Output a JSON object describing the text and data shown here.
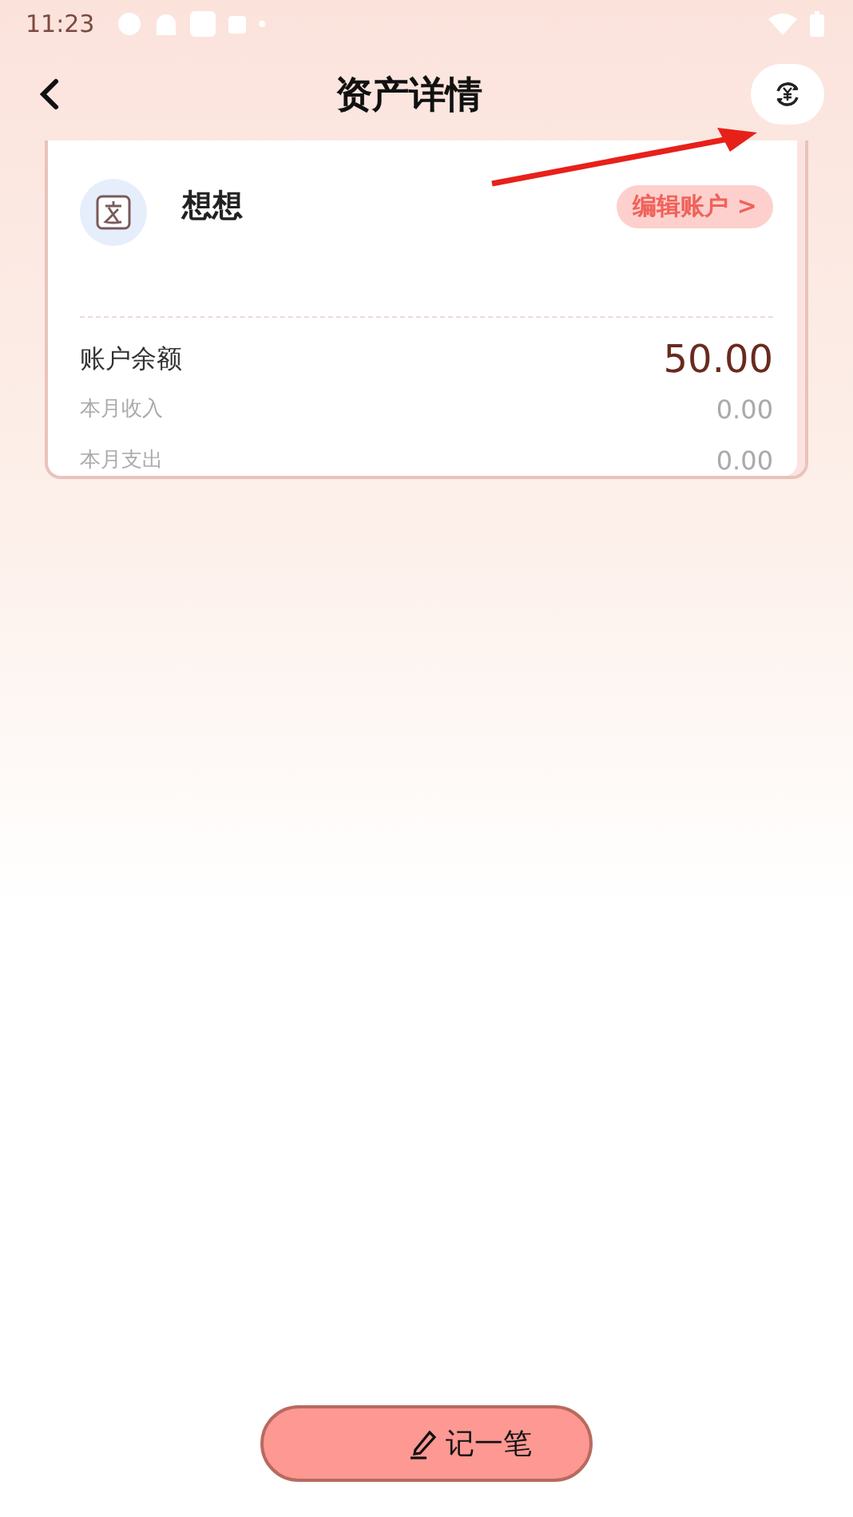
{
  "status_bar": {
    "time": "11:23"
  },
  "header": {
    "title": "资产详情"
  },
  "account": {
    "name": "想想",
    "edit_label": "编辑账户 >",
    "balance_label": "账户余额",
    "balance": "50.00",
    "rows": [
      {
        "label": "本月收入",
        "value": "0.00"
      },
      {
        "label": "本月支出",
        "value": "0.00"
      }
    ]
  },
  "record_button": {
    "label": "记一笔"
  }
}
